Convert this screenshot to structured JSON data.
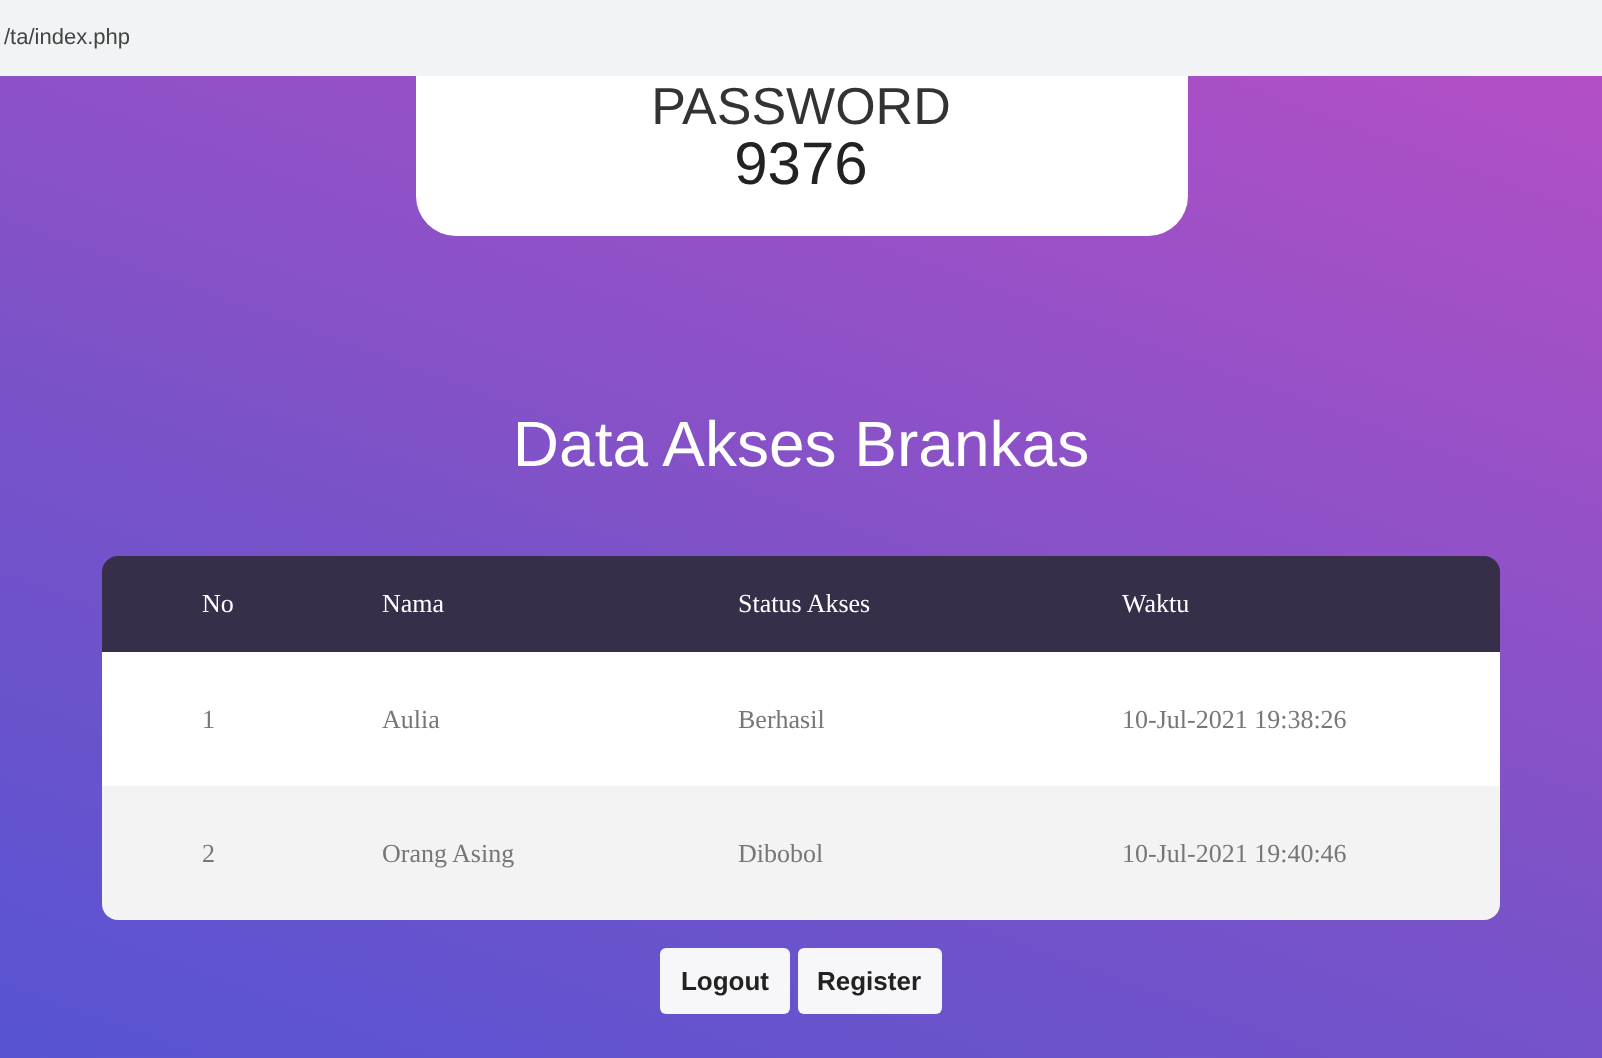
{
  "address_bar": {
    "url": "/ta/index.php"
  },
  "password_card": {
    "label": "PASSWORD",
    "value": "9376"
  },
  "heading": "Data Akses Brankas",
  "table": {
    "columns": [
      "No",
      "Nama",
      "Status Akses",
      "Waktu"
    ],
    "rows": [
      [
        "1",
        "Aulia",
        "Berhasil",
        "10-Jul-2021 19:38:26"
      ],
      [
        "2",
        "Orang Asing",
        "Dibobol",
        "10-Jul-2021 19:40:46"
      ]
    ]
  },
  "buttons": [
    "Logout",
    "Register"
  ]
}
